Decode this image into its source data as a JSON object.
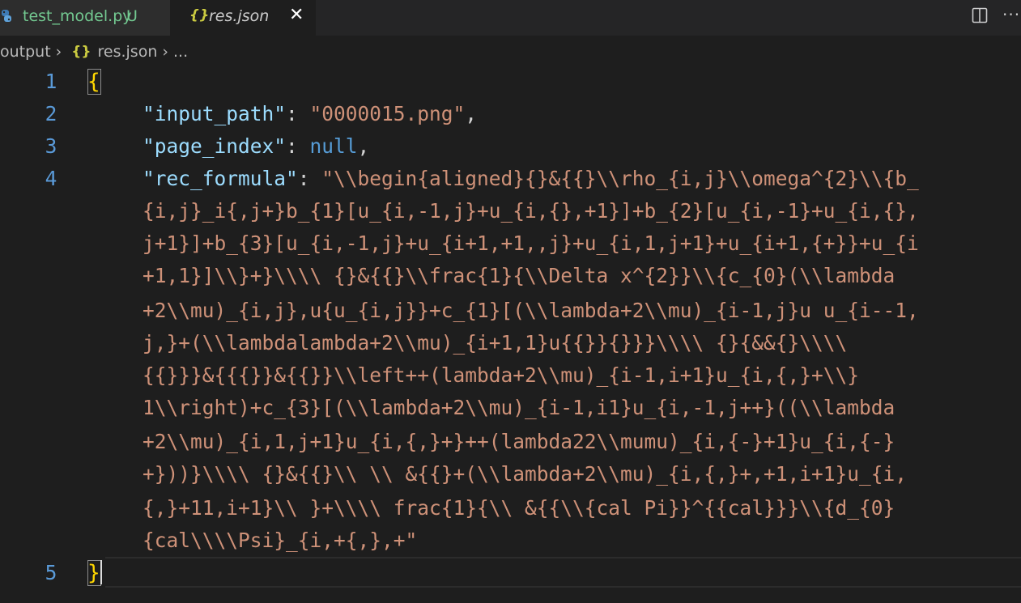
{
  "tabs": [
    {
      "name": "test_model.py",
      "status": "U",
      "icon": "python-icon",
      "active": false
    },
    {
      "name": "res.json",
      "icon": "json-icon",
      "icon_glyph": "{}",
      "active": true,
      "close_glyph": "✕"
    }
  ],
  "toolbar": {
    "more_glyph": "···"
  },
  "breadcrumb": {
    "folder": "output",
    "sep": "›",
    "json_glyph": "{}",
    "file": "res.json",
    "ellipsis": "..."
  },
  "editor": {
    "line_numbers": [
      "1",
      "2",
      "3",
      "4",
      "5"
    ],
    "open_brace": "{",
    "close_brace": "}",
    "lines": {
      "input_path": {
        "key": "\"input_path\"",
        "colon": ": ",
        "value": "\"0000015.png\"",
        "comma": ","
      },
      "page_index": {
        "key": "\"page_index\"",
        "colon": ": ",
        "value": "null",
        "comma": ","
      },
      "rec_formula": {
        "key": "\"rec_formula\"",
        "colon": ": ",
        "wrapped_value": [
          "\"\\\\begin{aligned}{}&{{}\\\\rho_{i,j}\\\\omega^{2}\\\\{b_",
          "{i,j}_i{,j+}b_{1}[u_{i,-1,j}+u_{i,{},+1}]+b_{2}[u_{i,-1}+u_{i,{},",
          "j+1}]+b_{3}[u_{i,-1,j}+u_{i+1,+1,,j}+u_{i,1,j+1}+u_{i+1,{+}}+u_{i",
          "+1,1}]\\\\}+}\\\\\\\\ {}&{{}\\\\frac{1}{\\\\Delta x^{2}}\\\\{c_{0}(\\\\lambda",
          "+2\\\\mu)_{i,j},u{u_{i,j}}+c_{1}[(\\\\lambda+2\\\\mu)_{i-1,j}u u_{i--1,",
          "j,}+(\\\\lambdalambda+2\\\\mu)_{i+1,1}u{{}}{}}}\\\\\\\\ {}{&&{}\\\\\\\\",
          "{{}}}&{{{}}&{{}}\\\\left++(lambda+2\\\\mu)_{i-1,i+1}u_{i,{,}+\\\\}",
          "1\\\\right)+c_{3}[(\\\\lambda+2\\\\mu)_{i-1,i1}u_{i,-1,j++}((\\\\lambda",
          "+2\\\\mu)_{i,1,j+1}u_{i,{,}+}++(lambda22\\\\mumu)_{i,{-}+1}u_{i,{-}",
          "+}))}\\\\\\\\ {}&{{}\\\\ \\\\ &{{}+(\\\\lambda+2\\\\mu)_{i,{,}+,+1,i+1}u_{i,",
          "{,}+11,i+1}\\\\ }+\\\\\\\\ frac{1}{\\\\ &{{\\\\{cal Pi}}^{{cal}}}\\\\{d_{0}",
          "{cal\\\\\\\\Psi}_{i,+{,},+\""
        ]
      }
    }
  }
}
